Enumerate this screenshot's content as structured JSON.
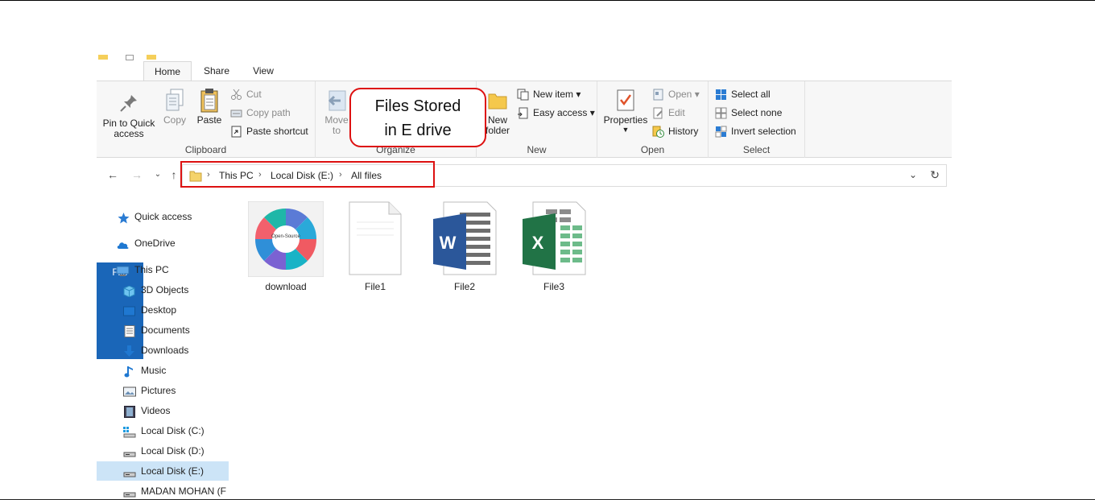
{
  "ribbon": {
    "tabs": {
      "file": "File",
      "home": "Home",
      "share": "Share",
      "view": "View"
    },
    "clipboard": {
      "group_label": "Clipboard",
      "pin_label": "Pin to Quick access",
      "copy_label": "Copy",
      "paste_label": "Paste",
      "cut_label": "Cut",
      "copy_path_label": "Copy path",
      "paste_shortcut_label": "Paste shortcut"
    },
    "organize": {
      "group_label": "Organize",
      "move_to_label": "Move to"
    },
    "new": {
      "group_label": "New",
      "new_folder_label": "New folder",
      "new_item_label": "New item",
      "easy_access_label": "Easy access"
    },
    "open": {
      "group_label": "Open",
      "properties_label": "Properties",
      "open_label": "Open",
      "edit_label": "Edit",
      "history_label": "History"
    },
    "select": {
      "group_label": "Select",
      "select_all_label": "Select all",
      "select_none_label": "Select none",
      "invert_selection_label": "Invert selection"
    }
  },
  "address": {
    "crumbs": [
      "This PC",
      "Local Disk (E:)",
      "All files"
    ]
  },
  "nav_pane": {
    "items": [
      {
        "label": "Quick access",
        "icon": "star-icon"
      },
      {
        "label": "OneDrive",
        "icon": "cloud-icon"
      },
      {
        "label": "This PC",
        "icon": "computer-icon"
      },
      {
        "label": "3D Objects",
        "icon": "cube-icon"
      },
      {
        "label": "Desktop",
        "icon": "desktop-icon"
      },
      {
        "label": "Documents",
        "icon": "document-icon"
      },
      {
        "label": "Downloads",
        "icon": "download-arrow-icon"
      },
      {
        "label": "Music",
        "icon": "music-note-icon"
      },
      {
        "label": "Pictures",
        "icon": "picture-icon"
      },
      {
        "label": "Videos",
        "icon": "film-icon"
      },
      {
        "label": "Local Disk (C:)",
        "icon": "windows-drive-icon"
      },
      {
        "label": "Local Disk (D:)",
        "icon": "drive-icon"
      },
      {
        "label": "Local Disk (E:)",
        "icon": "drive-icon",
        "selected": true
      },
      {
        "label": "MADAN MOHAN (F",
        "icon": "drive-icon"
      }
    ]
  },
  "files": [
    {
      "name": "download",
      "type": "image"
    },
    {
      "name": "File1",
      "type": "text"
    },
    {
      "name": "File2",
      "type": "word"
    },
    {
      "name": "File3",
      "type": "excel"
    }
  ],
  "thumbnail": {
    "center_label": "Open-Source"
  },
  "callout": {
    "line1": "Files Stored",
    "line2": "in E drive"
  },
  "colors": {
    "file_tab": "#1a66b8",
    "selected_nav": "#cce4f7",
    "annotation_red": "#dd1111",
    "word_blue": "#2b579a",
    "excel_green": "#217346"
  }
}
